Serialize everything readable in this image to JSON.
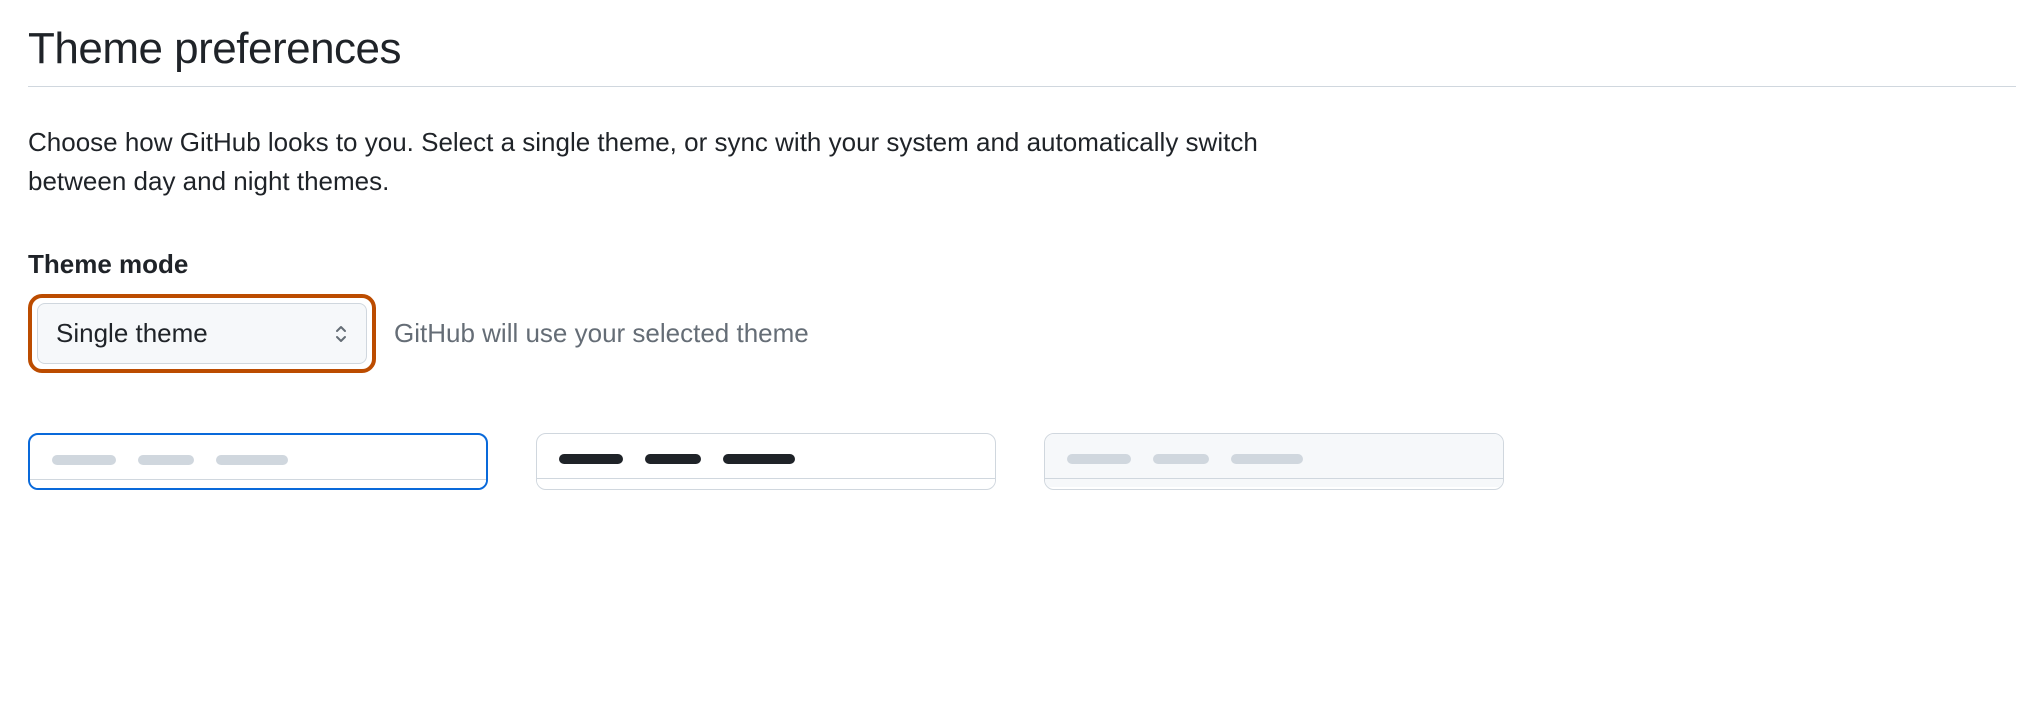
{
  "page": {
    "title": "Theme preferences",
    "description": "Choose how GitHub looks to you. Select a single theme, or sync with your system and automatically switch between day and night themes."
  },
  "themeMode": {
    "label": "Theme mode",
    "selected": "Single theme",
    "helper": "GitHub will use your selected theme"
  }
}
